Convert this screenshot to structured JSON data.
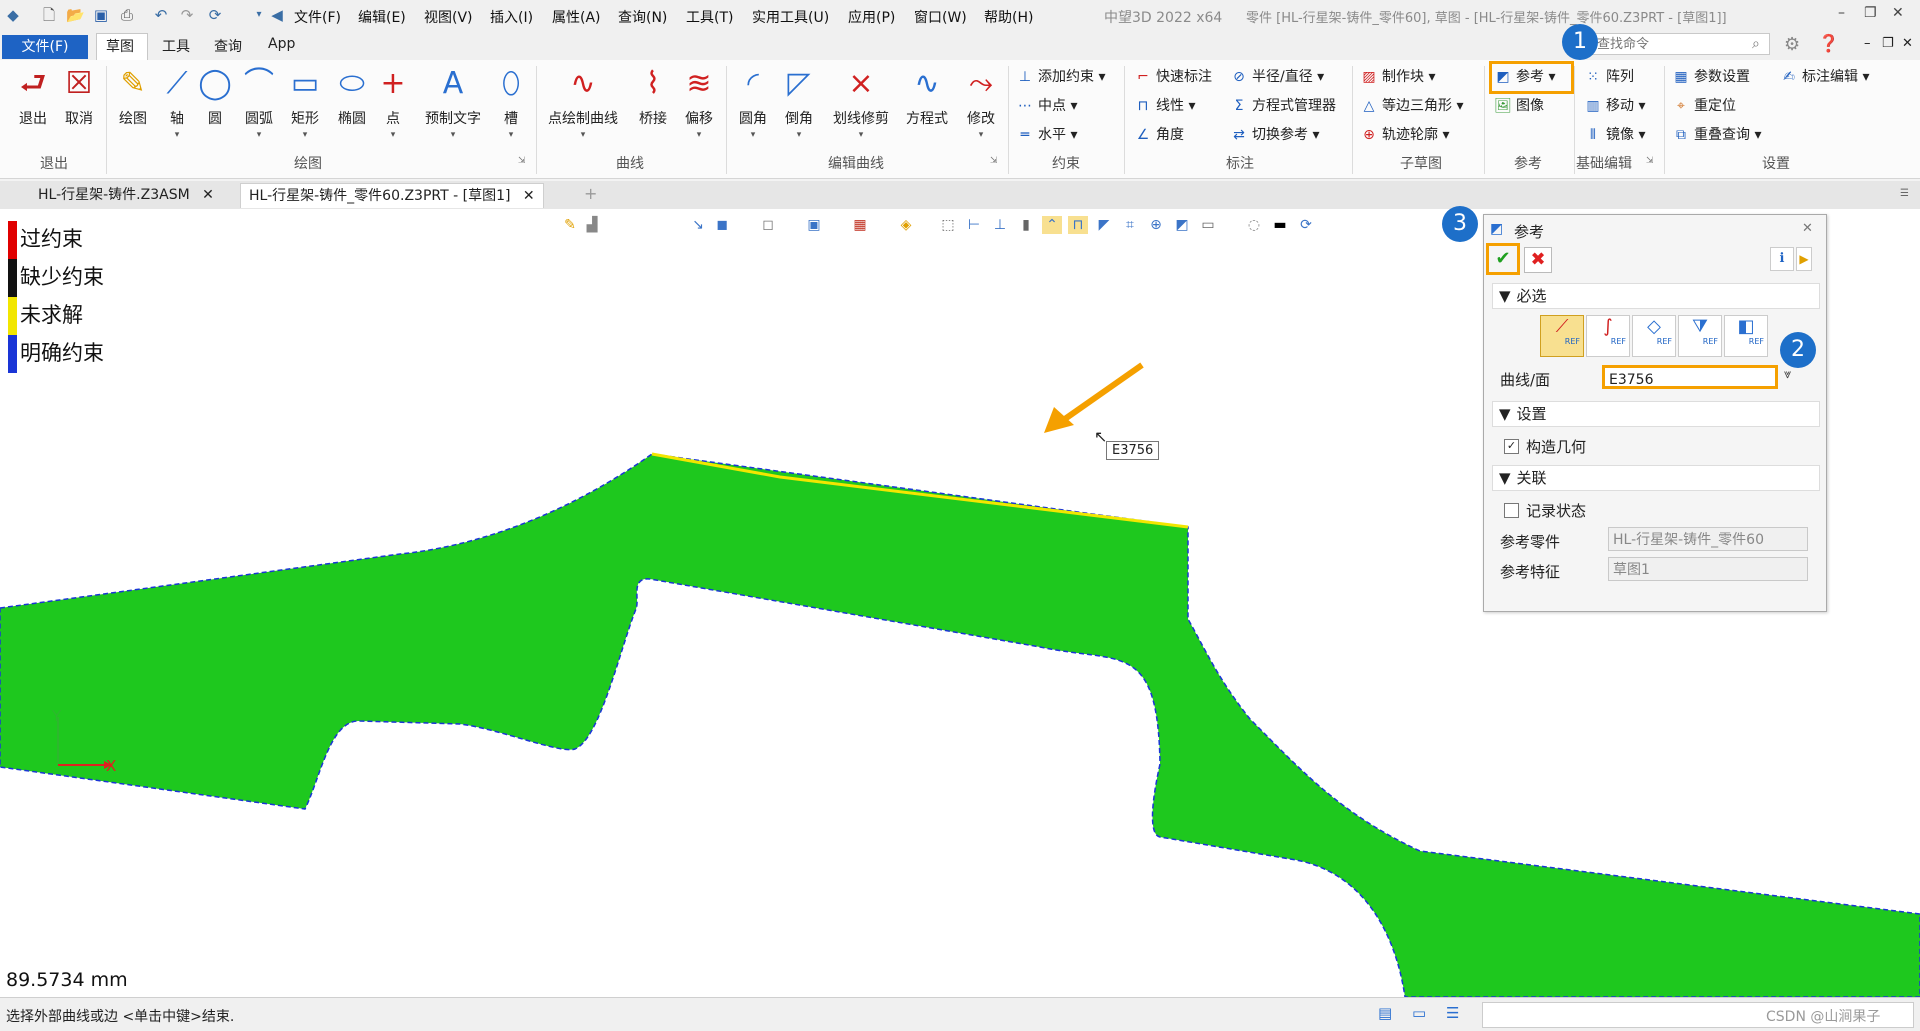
{
  "titlebar": {
    "menus": [
      "文件(F)",
      "编辑(E)",
      "视图(V)",
      "插入(I)",
      "属性(A)",
      "查询(N)",
      "工具(T)",
      "实用工具(U)",
      "应用(P)",
      "窗口(W)",
      "帮助(H)"
    ],
    "app_name": "中望3D 2022 x64",
    "window_title": "零件 [HL-行星架-铸件_零件60], 草图 - [HL-行星架-铸件_零件60.Z3PRT - [草图1]]"
  },
  "ribbon_tabs": {
    "file": "文件(F)",
    "tabs": [
      "草图",
      "工具",
      "查询",
      "App"
    ],
    "search_placeholder": "查找命令"
  },
  "ribbon": {
    "exit_group": {
      "label": "退出",
      "buttons": [
        "退出",
        "取消"
      ]
    },
    "draw_group": {
      "label": "绘图",
      "buttons": [
        "绘图",
        "轴",
        "圆",
        "圆弧",
        "矩形",
        "椭圆",
        "点",
        "预制文字",
        "槽"
      ]
    },
    "curve_group": {
      "label": "曲线",
      "buttons": [
        "点绘制曲线",
        "桥接",
        "偏移"
      ]
    },
    "edit_curve_group": {
      "label": "编辑曲线",
      "buttons": [
        "圆角",
        "倒角",
        "划线修剪",
        "方程式",
        "修改"
      ]
    },
    "constraint_group": {
      "label": "约束",
      "items": [
        "添加约束",
        "中点",
        "水平"
      ]
    },
    "dim_group": {
      "label": "标注",
      "items": [
        "快速标注",
        "线性",
        "角度",
        "半径/直径",
        "方程式管理器",
        "切换参考"
      ]
    },
    "subsketch_group": {
      "label": "子草图",
      "items": [
        "制作块",
        "等边三角形",
        "轨迹轮廓"
      ]
    },
    "ref_group": {
      "label": "参考",
      "items": [
        "参考",
        "图像"
      ]
    },
    "basic_edit_group": {
      "label": "基础编辑",
      "items": [
        "阵列",
        "移动",
        "镜像"
      ]
    },
    "settings_group": {
      "label": "设置",
      "items": [
        "参数设置",
        "重定位",
        "重叠查询",
        "标注编辑"
      ]
    }
  },
  "doc_tabs": [
    {
      "label": "HL-行星架-铸件.Z3ASM"
    },
    {
      "label": "HL-行星架-铸件_零件60.Z3PRT - [草图1]"
    }
  ],
  "legend": [
    {
      "label": "过约束",
      "color": "#e00000"
    },
    {
      "label": "缺少约束",
      "color": "#111111"
    },
    {
      "label": "未求解",
      "color": "#f2e600"
    },
    {
      "label": "明确约束",
      "color": "#1a35d6"
    }
  ],
  "canvas": {
    "tooltip": "E3756",
    "axis_y": "Y",
    "axis_x": "X",
    "measure": "89.5734 mm",
    "shape_fill": "#1ec81e"
  },
  "panel": {
    "title": "参考",
    "section_required": "必选",
    "curve_face_label": "曲线/面",
    "curve_face_value": "E3756",
    "section_settings": "设置",
    "construct_geometry": "构造几何",
    "section_assoc": "关联",
    "record_state": "记录状态",
    "ref_part_label": "参考零件",
    "ref_part_value": "HL-行星架-铸件_零件60",
    "ref_feature_label": "参考特征",
    "ref_feature_value": "草图1",
    "ref_icon_text": "REF"
  },
  "callouts": [
    "1",
    "2",
    "3"
  ],
  "statusbar": {
    "prompt": "选择外部曲线或边 <单击中键>结束.",
    "watermark": "CSDN @山涧果子"
  }
}
